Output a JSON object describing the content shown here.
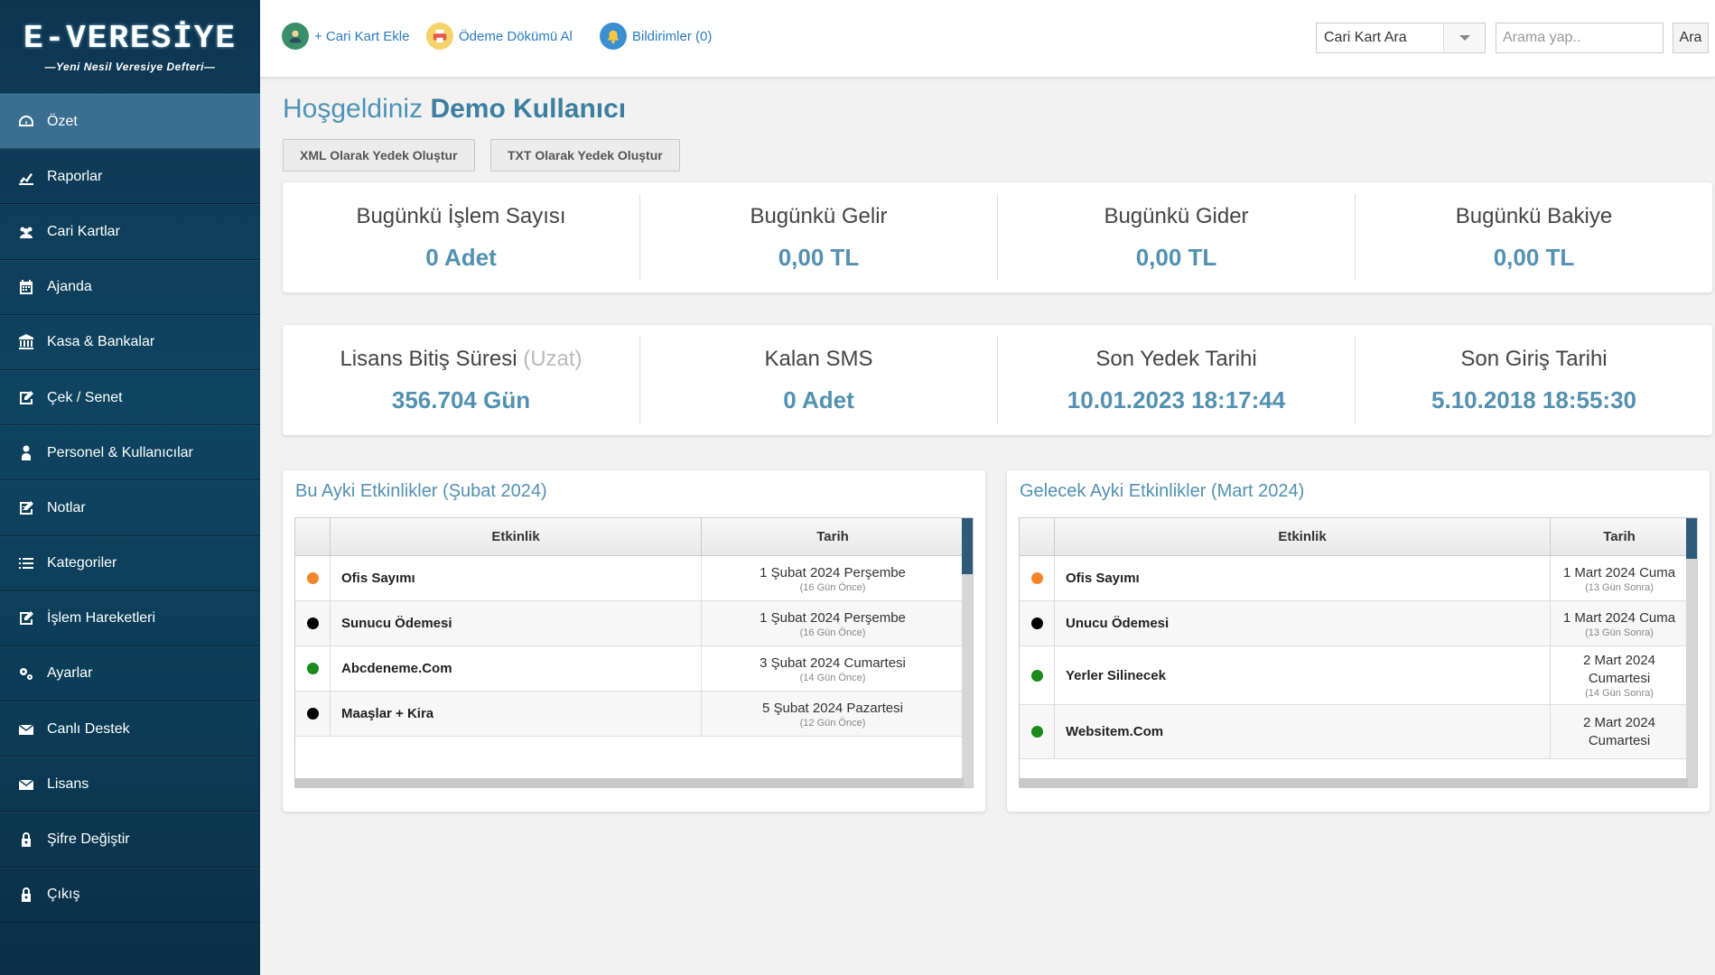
{
  "brand": {
    "title": "E-VERESİYE",
    "tagline": "—Yeni Nesil Veresiye Defteri—"
  },
  "sidebar": {
    "items": [
      {
        "label": "Özet",
        "icon": "dashboard-icon",
        "active": true
      },
      {
        "label": "Raporlar",
        "icon": "chart-icon"
      },
      {
        "label": "Cari Kartlar",
        "icon": "users-icon"
      },
      {
        "label": "Ajanda",
        "icon": "calendar-icon"
      },
      {
        "label": "Kasa & Bankalar",
        "icon": "bank-icon"
      },
      {
        "label": "Çek / Senet",
        "icon": "edit-icon"
      },
      {
        "label": "Personel & Kullanıcılar",
        "icon": "user-icon"
      },
      {
        "label": "Notlar",
        "icon": "notes-icon"
      },
      {
        "label": "Kategoriler",
        "icon": "list-icon"
      },
      {
        "label": "İşlem Hareketleri",
        "icon": "edit-icon"
      },
      {
        "label": "Ayarlar",
        "icon": "gears-icon"
      },
      {
        "label": "Canlı Destek",
        "icon": "envelope-icon"
      },
      {
        "label": "Lisans",
        "icon": "envelope-icon"
      },
      {
        "label": "Şifre Değiştir",
        "icon": "lock-icon"
      },
      {
        "label": "Çıkış",
        "icon": "lock-icon"
      }
    ]
  },
  "topbar": {
    "add_card": "+ Cari Kart Ekle",
    "payment": "Ödeme Dökümü Al",
    "notifications": "Bildirimler (0)",
    "select_value": "Cari Kart Ara",
    "search_placeholder": "Arama yap..",
    "search_button": "Ara"
  },
  "welcome": {
    "prefix": "Hoşgeldiniz",
    "name": "Demo Kullanıcı"
  },
  "backup": {
    "xml": "XML Olarak Yedek Oluştur",
    "txt": "TXT Olarak Yedek Oluştur"
  },
  "stats_today": [
    {
      "label": "Bugünkü İşlem Sayısı",
      "value": "0 Adet"
    },
    {
      "label": "Bugünkü Gelir",
      "value": "0,00 TL"
    },
    {
      "label": "Bugünkü Gider",
      "value": "0,00 TL"
    },
    {
      "label": "Bugünkü Bakiye",
      "value": "0,00 TL"
    }
  ],
  "stats_info": [
    {
      "label": "Lisans Bitiş Süresi",
      "extra": "(Uzat)",
      "value": "356.704 Gün"
    },
    {
      "label": "Kalan SMS",
      "value": "0 Adet"
    },
    {
      "label": "Son Yedek Tarihi",
      "value": "10.01.2023 18:17:44"
    },
    {
      "label": "Son Giriş Tarihi",
      "value": "5.10.2018 18:55:30"
    }
  ],
  "events_this_month": {
    "title": "Bu Ayki Etkinlikler (Şubat 2024)",
    "col_event": "Etkinlik",
    "col_date": "Tarih",
    "rows": [
      {
        "color": "#f5852a",
        "name": "Ofis Sayımı",
        "date": "1 Şubat 2024 Perşembe",
        "rel": "(16 Gün Önce)"
      },
      {
        "color": "#000000",
        "name": "Sunucu Ödemesi",
        "date": "1 Şubat 2024 Perşembe",
        "rel": "(16 Gün Önce)"
      },
      {
        "color": "#1a8a1a",
        "name": "Abcdeneme.Com",
        "date": "3 Şubat 2024 Cumartesi",
        "rel": "(14 Gün Önce)"
      },
      {
        "color": "#000000",
        "name": "Maaşlar + Kira",
        "date": "5 Şubat 2024 Pazartesi",
        "rel": "(12 Gün Önce)"
      }
    ]
  },
  "events_next_month": {
    "title": "Gelecek Ayki Etkinlikler (Mart 2024)",
    "col_event": "Etkinlik",
    "col_date": "Tarih",
    "rows": [
      {
        "color": "#f5852a",
        "name": "Ofis Sayımı",
        "date": "1 Mart 2024 Cuma",
        "rel": "(13 Gün Sonra)"
      },
      {
        "color": "#000000",
        "name": "Unucu Ödemesi",
        "date": "1 Mart 2024 Cuma",
        "rel": "(13 Gün Sonra)"
      },
      {
        "color": "#1a8a1a",
        "name": "Yerler Silinecek",
        "date": "2 Mart 2024 Cumartesi",
        "rel": "(14 Gün Sonra)"
      },
      {
        "color": "#1a8a1a",
        "name": "Websitem.Com",
        "date": "2 Mart 2024 Cumartesi",
        "rel": ""
      }
    ]
  }
}
